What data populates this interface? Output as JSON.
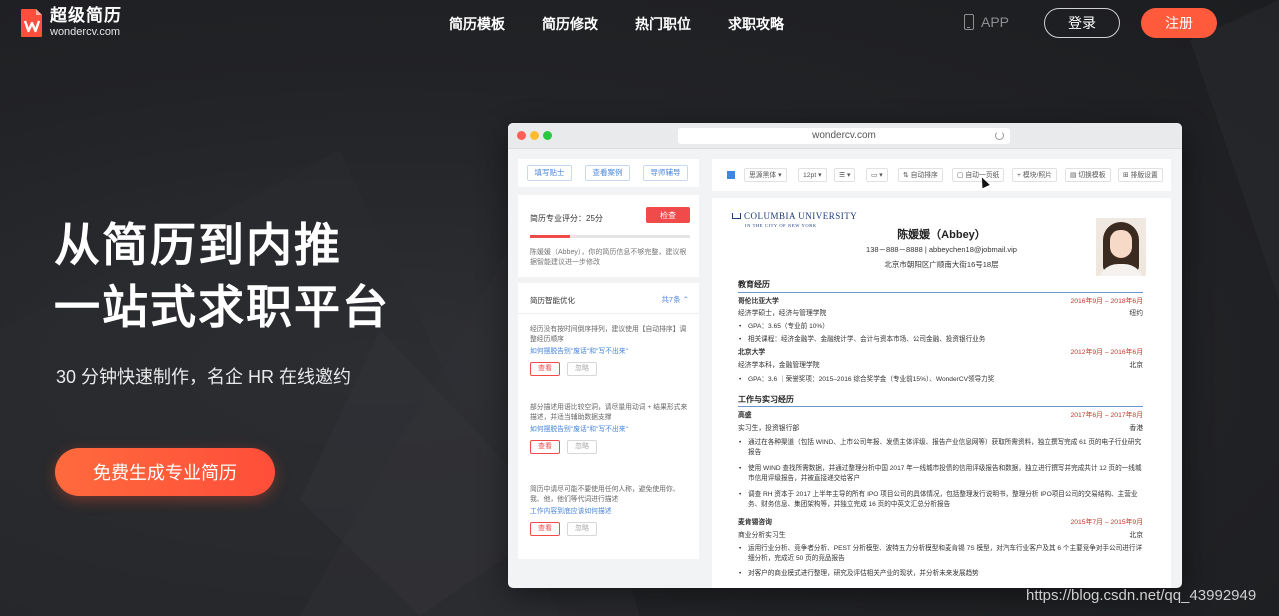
{
  "header": {
    "logo_name": "超级简历",
    "logo_domain": "wondercv.com",
    "nav": [
      "简历模板",
      "简历修改",
      "热门职位",
      "求职攻略"
    ],
    "app_label": "APP",
    "login_label": "登录",
    "register_label": "注册"
  },
  "hero": {
    "title_line1": "从简历到内推",
    "title_line2": "一站式求职平台",
    "subtitle": "30 分钟快速制作，名企 HR 在线邀约",
    "cta_label": "免费生成专业简历"
  },
  "colors": {
    "accent": "#ff5a3c",
    "link_blue": "#4a86d8",
    "check_red": "#f04a4a"
  },
  "mockup": {
    "url": "wondercv.com",
    "left": {
      "tools": [
        "填写贴士",
        "查看案例",
        "导师辅导"
      ],
      "score_label": "简历专业评分：25分",
      "score_progress_percent": 25,
      "check_label": "检查",
      "score_note": "陈媛媛（Abbey），你的简历信息不够完整，建议根据智能建议进一步修改",
      "optimize_title": "简历智能优化",
      "optimize_count": "共7条",
      "suggestions": [
        {
          "text": "经历没有按时间倒序排列，建议使用【自动排序】调整经历顺序",
          "link": "如何摆脱告别\"废话\"和\"写不出来\"",
          "view": "查看",
          "ignore": "忽略"
        },
        {
          "text": "部分描述用语比较空洞，请尽量用动词 + 结果形式来描述，并适当辅助数据支撑",
          "link": "如何摆脱告别\"废话\"和\"写不出来\"",
          "view": "查看",
          "ignore": "忽略"
        },
        {
          "text": "简历中请尽可能不要使用任何人称，避免使用你、我、他，他们等代词进行描述",
          "link": "工作内容到底应该如何描述",
          "view": "查看",
          "ignore": "忽略"
        }
      ]
    },
    "toolbar": [
      "思源黑体",
      "12pt",
      "自动排序",
      "自动一页纸",
      "模块/照片",
      "切换模板",
      "排版设置"
    ],
    "resume": {
      "school_logo": "COLUMBIA UNIVERSITY",
      "school_logo_sub": "IN THE CITY OF NEW YORK",
      "name": "陈媛媛（Abbey）",
      "contact": "138－888－8888 | abbeychen18@jobmail.vip",
      "address": "北京市朝阳区广顺南大街16号18层",
      "edu_title": "教育经历",
      "edu": [
        {
          "school": "哥伦比亚大学",
          "date": "2016年9月 – 2018年6月",
          "degree": "经济学硕士，经济与管理学院",
          "place": "纽约",
          "bullets": [
            "GPA：3.65（专业前 10%）",
            "相关课程：经济金融学、金融统计学、会计与资本市场、公司金融、投资银行业务"
          ]
        },
        {
          "school": "北京大学",
          "date": "2012年9月 – 2016年6月",
          "degree": "经济学本科，金融管理学院",
          "place": "北京",
          "bullets": [
            "GPA：3.6 ｜荣誉奖项：2015–2016 综合奖学金（专业前15%）、WonderCV领导力奖"
          ]
        }
      ],
      "work_title": "工作与实习经历",
      "work": [
        {
          "company": "高盛",
          "date": "2017年6月 – 2017年8月",
          "role": "实习生，投资银行部",
          "place": "香港",
          "bullets": [
            "通过在各种渠道（包括 WIND、上市公司年报、发债主体评级、报告产业信息网等）获取所需资料，独立撰写完成 61 页的电子行业研究报告",
            "使用 WIND 查找所需数据，并通过整理分析中国 2017 年一线城市投债的信用评级报告和数据，独立进行撰写并完成共计 12 页的一线城市信用评级报告，并被直接递交给客户",
            "调查 RH 资本于 2017 上半年主导的所有 IPO 项目公司的具体情况，包括整理发行说明书，整理分析 IPO项目公司的交易结构、主营业务、财务信息、集团架构等，并独立完成 16 页的中英文汇总分析报告"
          ]
        },
        {
          "company": "麦肯锡咨询",
          "date": "2015年7月 – 2015年9月",
          "role": "商业分析实习生",
          "place": "北京",
          "bullets": [
            "运用行业分析、竞争者分析、PEST 分析模型、波特五力分析模型和麦肯锡 7S 模型，对汽车行业客户及其 6 个主要竞争对手公司进行详细分析，完成近 50 页的竞品报告",
            "对客户的商业模式进行整理，研究及评估相关产业的现状，并分析未来发展趋势"
          ]
        }
      ]
    }
  },
  "watermark": "https://blog.csdn.net/qq_43992949"
}
